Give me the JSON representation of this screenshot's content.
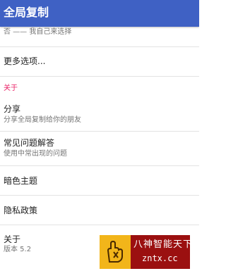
{
  "app_bar": {
    "title": "全局复制"
  },
  "settings": {
    "partial_item": {
      "summary": "否 —— 我自己来选择"
    },
    "more_options": {
      "title": "更多选项..."
    },
    "about_section": {
      "header": "关于",
      "header_color": "#e91e63",
      "items": [
        {
          "title": "分享",
          "summary": "分享全局复制给你的朋友"
        },
        {
          "title": "常见问题解答",
          "summary": "使用中常出现的问题"
        },
        {
          "title": "暗色主题",
          "summary": ""
        },
        {
          "title": "隐私政策",
          "summary": ""
        },
        {
          "title": "关于",
          "summary": "版本 5.2"
        }
      ]
    }
  },
  "watermark": {
    "line1": "八神智能天下",
    "line2": "zntx.cc"
  },
  "colors": {
    "app_bar": "#3f61c4",
    "divider": "#e3e3e3",
    "watermark_bg": "#9b1010",
    "watermark_logo": "#f2b51a"
  }
}
